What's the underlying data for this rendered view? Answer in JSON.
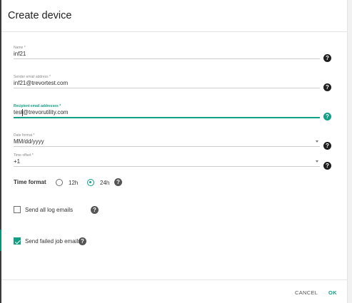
{
  "dialog": {
    "title": "Create device"
  },
  "fields": {
    "name": {
      "label": "Name *",
      "value": "inf21"
    },
    "sender": {
      "label": "Sender email address *",
      "value": "inf21@trevortest.com"
    },
    "recipient": {
      "label": "Recipient email addresses *",
      "value": "test@trevorutility.com",
      "value_before_cursor": "test",
      "value_after_cursor": "@trevorutility.com"
    },
    "date_format": {
      "label": "Date format *",
      "value": "MM/dd/yyyy"
    },
    "time_offset": {
      "label": "Time offset *",
      "value": "+1"
    }
  },
  "help_glyph": "?",
  "time_format": {
    "label": "Time format",
    "options": [
      {
        "label": "12h",
        "selected": false
      },
      {
        "label": "24h",
        "selected": true
      }
    ]
  },
  "checkboxes": {
    "send_all_log": {
      "label": "Send all log emails",
      "checked": false
    },
    "send_failed_job": {
      "label": "Send failed job emails",
      "checked": true
    }
  },
  "actions": {
    "cancel": "CANCEL",
    "ok": "OK"
  },
  "colors": {
    "accent": "#119f86",
    "text": "#212121",
    "help_icon": "#1f1f1f"
  },
  "icons": [
    "help-icon",
    "dropdown-arrow-icon",
    "radio-icon",
    "checkbox-icon",
    "checkmark-icon"
  ]
}
